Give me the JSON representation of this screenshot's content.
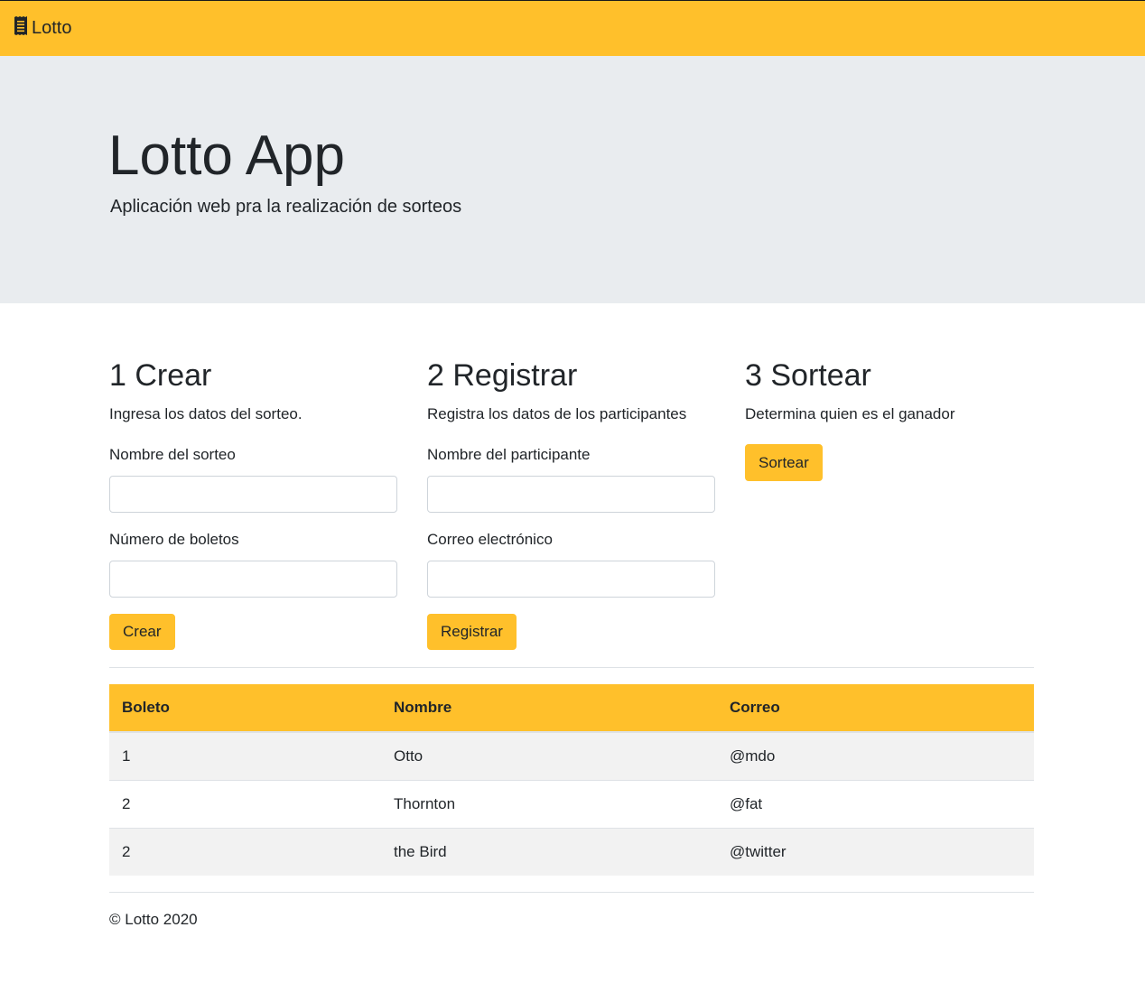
{
  "navbar": {
    "brand_icon": "receipt-icon",
    "brand_label": "Lotto",
    "color": "#ffc02b"
  },
  "hero": {
    "title": "Lotto App",
    "lead": "Aplicación web pra la realización de sorteos"
  },
  "step_create": {
    "heading": "1 Crear",
    "description": "Ingresa los datos del sorteo.",
    "name_label": "Nombre del sorteo",
    "name_value": "",
    "tickets_label": "Número de boletos",
    "tickets_value": "",
    "button_label": "Crear"
  },
  "step_register": {
    "heading": "2 Registrar",
    "description": "Registra los datos de los participantes",
    "participant_label": "Nombre del participante",
    "participant_value": "",
    "email_label": "Correo electrónico",
    "email_value": "",
    "button_label": "Registrar"
  },
  "step_draw": {
    "heading": "3 Sortear",
    "description": "Determina quien es el ganador",
    "button_label": "Sortear"
  },
  "table": {
    "headers": [
      "Boleto",
      "Nombre",
      "Correo"
    ],
    "rows": [
      [
        "1",
        "Otto",
        "@mdo"
      ],
      [
        "2",
        "Thornton",
        "@fat"
      ],
      [
        "2",
        "the Bird",
        "@twitter"
      ]
    ]
  },
  "footer": {
    "text": "© Lotto 2020"
  }
}
